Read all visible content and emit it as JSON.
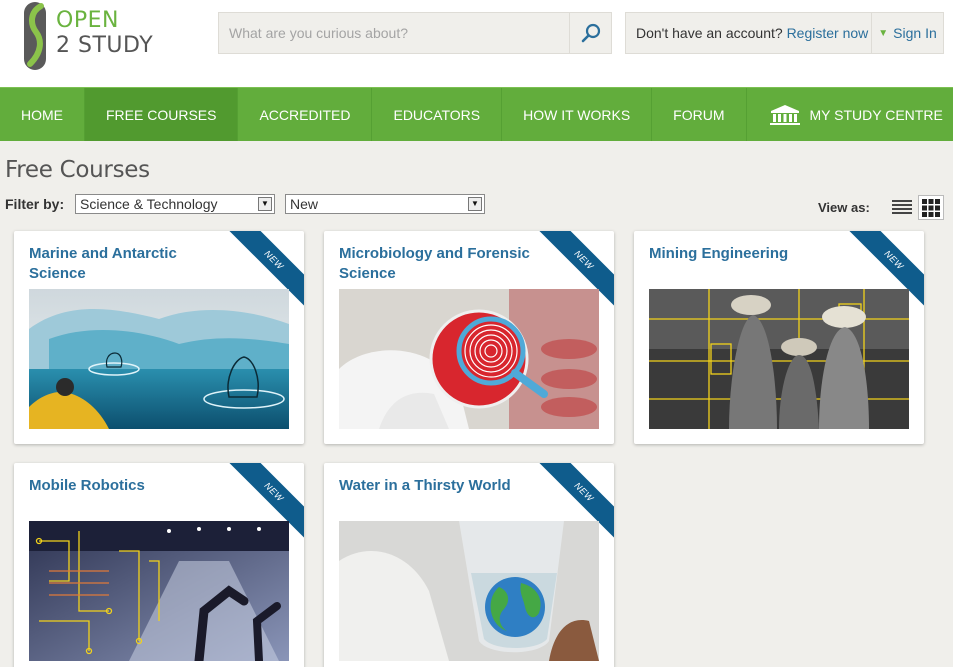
{
  "logo": {
    "line1": "OPEN",
    "line2": "2 STUDY"
  },
  "search": {
    "placeholder": "What are you curious about?"
  },
  "account": {
    "prompt": "Don't have an account?",
    "register": "Register now",
    "signin": "Sign In"
  },
  "nav": {
    "items": [
      {
        "label": "HOME"
      },
      {
        "label": "FREE COURSES"
      },
      {
        "label": "ACCREDITED"
      },
      {
        "label": "EDUCATORS"
      },
      {
        "label": "HOW IT WORKS"
      },
      {
        "label": "FORUM"
      },
      {
        "label": "MY STUDY CENTRE"
      }
    ]
  },
  "page": {
    "title": "Free Courses",
    "filter_label": "Filter by:",
    "filter_category": "Science & Technology",
    "filter_type": "New",
    "view_as": "View as:"
  },
  "courses": [
    {
      "title": "Marine and Antarctic Science",
      "badge": "NEW"
    },
    {
      "title": "Microbiology and Forensic Science",
      "badge": "NEW"
    },
    {
      "title": "Mining Engineering",
      "badge": "NEW"
    },
    {
      "title": "Mobile Robotics",
      "badge": "NEW"
    },
    {
      "title": "Water in a Thirsty World",
      "badge": "NEW"
    }
  ],
  "colors": {
    "brand_green": "#62ad3c",
    "link_blue": "#2b6f9c",
    "ribbon_blue": "#0f5c8c",
    "background": "#f0efeb"
  },
  "icons": [
    "logo-icon",
    "search-icon",
    "chevron-down-icon",
    "building-icon",
    "list-view-icon",
    "grid-view-icon"
  ]
}
